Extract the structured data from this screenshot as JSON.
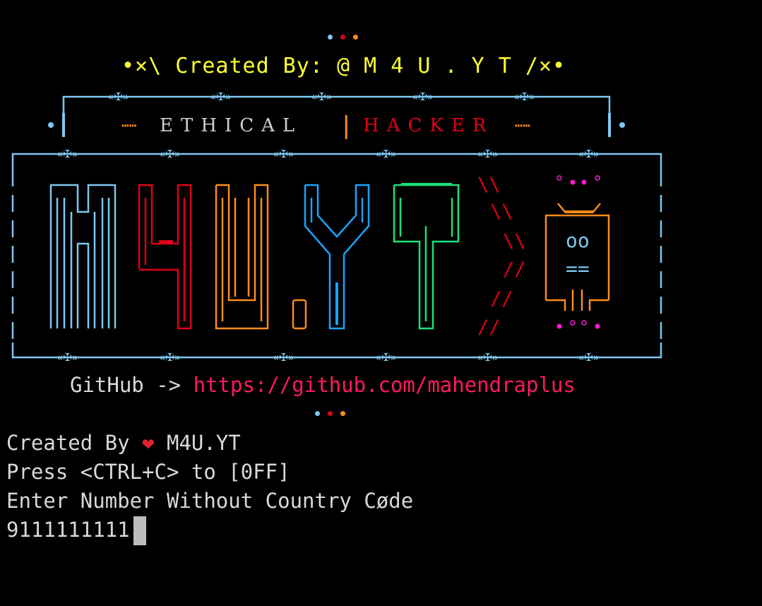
{
  "banner": {
    "credit_line": "•×\\ Created By: @ M 4 U . Y T /×•",
    "ethical": "ETHICAL",
    "separator": "|",
    "hacker": "HACKER",
    "deco_left": "┅┅",
    "deco_right": "┅┅",
    "left_dot": "•",
    "right_dot": "•",
    "frame_top": "┌──═─═«✠»═─═─═«✠»═─═─═«✠»═─═─═«✠»═─═─═«✠»═──┐",
    "frame_box_top": "┌─═─═«✠»═─═─═«✠»═─═─═─═«✠»═─═─═«✠»═─═─═─═«✠»═─═─═«✠»═─┐",
    "frame_box_bottom": "└─═─═«✠»═─═─═«✠»═─═─═─═«✠»═─═─═«✠»═─═─═─═«✠»═─═─═«✠»═─┘",
    "robot_face": "oo",
    "robot_mouth": "==",
    "github_label": "GitHub -> ",
    "github_url": "https://github.com/mahendraplus"
  },
  "terminal": {
    "line1_prefix": "Created By ",
    "heart": "❤",
    "line1_suffix": " M4U.YT",
    "line2": "Press <CTRL+C> to [0FF]",
    "line3": "Enter Number Without Country Cøde",
    "input_value": "9111111111"
  },
  "colors": {
    "background": "#000000",
    "text": "#d8d8d8",
    "credit": "#ffff33",
    "frame": "#7ec8f0",
    "red": "#e0001a",
    "orange": "#ff8c1a",
    "blue": "#1aa3ff",
    "green": "#1ae07a",
    "magenta": "#ff1ad6",
    "url": "#ff1a5e"
  }
}
